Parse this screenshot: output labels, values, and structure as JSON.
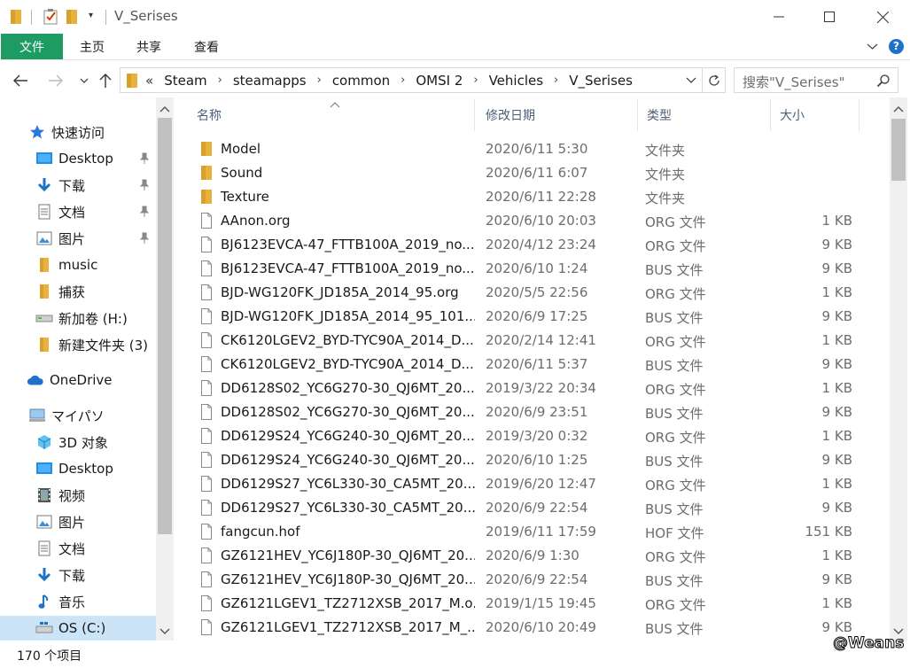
{
  "window": {
    "title": "V_Serises",
    "minimize": "—",
    "maximize": "☐",
    "close": "✕"
  },
  "ribbon": {
    "tabs": [
      "文件",
      "主页",
      "共享",
      "查看"
    ],
    "help": "?"
  },
  "address": {
    "lead": "«",
    "crumbs": [
      "Steam",
      "steamapps",
      "common",
      "OMSI 2",
      "Vehicles",
      "V_Serises"
    ],
    "search_placeholder": "搜索\"V_Serises\""
  },
  "nav_pane": {
    "items": [
      {
        "label": "快速访问",
        "icon": "star-icon",
        "pinned": false
      },
      {
        "label": "Desktop",
        "icon": "desktop-icon",
        "pinned": true
      },
      {
        "label": "下载",
        "icon": "download-icon",
        "pinned": true
      },
      {
        "label": "文档",
        "icon": "document-icon",
        "pinned": true
      },
      {
        "label": "图片",
        "icon": "pictures-icon",
        "pinned": true
      },
      {
        "label": "music",
        "icon": "folder-icon",
        "pinned": false
      },
      {
        "label": "捕获",
        "icon": "folder-icon",
        "pinned": false
      },
      {
        "label": "新加卷 (H:)",
        "icon": "drive-icon",
        "pinned": false
      },
      {
        "label": "新建文件夹 (3)",
        "icon": "folder-icon",
        "pinned": false
      },
      {
        "label": "OneDrive",
        "icon": "cloud-icon",
        "pinned": false
      },
      {
        "label": "マイパソ",
        "icon": "computer-icon",
        "pinned": false
      },
      {
        "label": "3D 对象",
        "icon": "cube-icon",
        "pinned": false
      },
      {
        "label": "Desktop",
        "icon": "desktop-icon",
        "pinned": false
      },
      {
        "label": "视频",
        "icon": "video-icon",
        "pinned": false
      },
      {
        "label": "图片",
        "icon": "pictures-icon",
        "pinned": false
      },
      {
        "label": "文档",
        "icon": "document-icon",
        "pinned": false
      },
      {
        "label": "下载",
        "icon": "download-icon",
        "pinned": false
      },
      {
        "label": "音乐",
        "icon": "music-icon",
        "pinned": false
      },
      {
        "label": "OS (C:)",
        "icon": "windows-drive-icon",
        "pinned": false
      }
    ]
  },
  "columns": {
    "name": "名称",
    "date": "修改日期",
    "type": "类型",
    "size": "大小"
  },
  "files": [
    {
      "name": "Model",
      "date": "2020/6/11 5:30",
      "type": "文件夹",
      "size": "",
      "kind": "folder"
    },
    {
      "name": "Sound",
      "date": "2020/6/11 6:07",
      "type": "文件夹",
      "size": "",
      "kind": "folder"
    },
    {
      "name": "Texture",
      "date": "2020/6/11 22:28",
      "type": "文件夹",
      "size": "",
      "kind": "folder"
    },
    {
      "name": "AAnon.org",
      "date": "2020/6/10 20:03",
      "type": "ORG 文件",
      "size": "1 KB",
      "kind": "file"
    },
    {
      "name": "BJ6123EVCA-47_FTTB100A_2019_no...",
      "date": "2020/4/12 23:24",
      "type": "ORG 文件",
      "size": "9 KB",
      "kind": "file"
    },
    {
      "name": "BJ6123EVCA-47_FTTB100A_2019_no...",
      "date": "2020/6/10 1:24",
      "type": "BUS 文件",
      "size": "9 KB",
      "kind": "file"
    },
    {
      "name": "BJD-WG120FK_JD185A_2014_95.org",
      "date": "2020/5/5 22:56",
      "type": "ORG 文件",
      "size": "1 KB",
      "kind": "file"
    },
    {
      "name": "BJD-WG120FK_JD185A_2014_95_101...",
      "date": "2020/6/9 17:25",
      "type": "BUS 文件",
      "size": "9 KB",
      "kind": "file"
    },
    {
      "name": "CK6120LGEV2_BYD-TYC90A_2014_D...",
      "date": "2020/2/14 12:41",
      "type": "ORG 文件",
      "size": "1 KB",
      "kind": "file"
    },
    {
      "name": "CK6120LGEV2_BYD-TYC90A_2014_D...",
      "date": "2020/6/11 5:37",
      "type": "BUS 文件",
      "size": "9 KB",
      "kind": "file"
    },
    {
      "name": "DD6128S02_YC6G270-30_QJ6MT_20...",
      "date": "2019/3/22 20:34",
      "type": "ORG 文件",
      "size": "1 KB",
      "kind": "file"
    },
    {
      "name": "DD6128S02_YC6G270-30_QJ6MT_20...",
      "date": "2020/6/9 23:51",
      "type": "BUS 文件",
      "size": "9 KB",
      "kind": "file"
    },
    {
      "name": "DD6129S24_YC6G240-30_QJ6MT_20...",
      "date": "2019/3/20 0:32",
      "type": "ORG 文件",
      "size": "1 KB",
      "kind": "file"
    },
    {
      "name": "DD6129S24_YC6G240-30_QJ6MT_20...",
      "date": "2020/6/10 1:25",
      "type": "BUS 文件",
      "size": "9 KB",
      "kind": "file"
    },
    {
      "name": "DD6129S27_YC6L330-30_CA5MT_20...",
      "date": "2019/6/20 12:47",
      "type": "ORG 文件",
      "size": "1 KB",
      "kind": "file"
    },
    {
      "name": "DD6129S27_YC6L330-30_CA5MT_20...",
      "date": "2020/6/9 22:54",
      "type": "BUS 文件",
      "size": "9 KB",
      "kind": "file"
    },
    {
      "name": "fangcun.hof",
      "date": "2019/6/11 17:59",
      "type": "HOF 文件",
      "size": "151 KB",
      "kind": "file"
    },
    {
      "name": "GZ6121HEV_YC6J180P-30_QJ6MT_20...",
      "date": "2020/6/9 1:30",
      "type": "ORG 文件",
      "size": "1 KB",
      "kind": "file"
    },
    {
      "name": "GZ6121HEV_YC6J180P-30_QJ6MT_20...",
      "date": "2020/6/9 22:54",
      "type": "BUS 文件",
      "size": "9 KB",
      "kind": "file"
    },
    {
      "name": "GZ6121LGEV1_TZ2712XSB_2017_M.o...",
      "date": "2019/1/15 19:45",
      "type": "ORG 文件",
      "size": "1 KB",
      "kind": "file"
    },
    {
      "name": "GZ6121LGEV1_TZ2712XSB_2017_M_...",
      "date": "2020/6/10 20:49",
      "type": "BUS 文件",
      "size": "9 KB",
      "kind": "file"
    }
  ],
  "status": {
    "count": "170 个项目"
  },
  "watermark": "@Weans",
  "colors": {
    "file_tab": "#1e9b62",
    "folder": "#e8b23c",
    "accent_blue": "#1e73c8",
    "selected": "#cce4f7"
  }
}
